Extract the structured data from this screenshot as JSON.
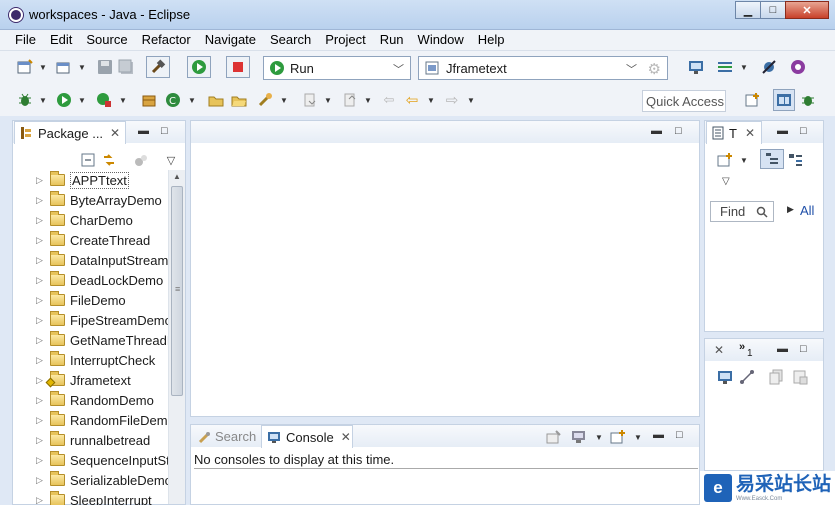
{
  "window": {
    "title": "workspaces - Java - Eclipse",
    "minimize": "▁",
    "maximize": "□",
    "close": "✕"
  },
  "menu": [
    "File",
    "Edit",
    "Source",
    "Refactor",
    "Navigate",
    "Search",
    "Project",
    "Run",
    "Window",
    "Help"
  ],
  "toolbar": {
    "run_config": "Run",
    "project": "Jframetext",
    "quick_access": "Quick Access"
  },
  "package_explorer": {
    "tab_label": "Package ...",
    "projects": [
      "APPTtext",
      "ByteArrayDemo",
      "CharDemo",
      "CreateThread",
      "DataInputStreamDe",
      "DeadLockDemo",
      "FileDemo",
      "FipeStreamDemo",
      "GetNameThreadDe",
      "InterruptCheck",
      "Jframetext",
      "RandomDemo",
      "RandomFileDemo",
      "runnalbetread",
      "SequenceInputStre",
      "SerializableDemo",
      "SleepInterrupt"
    ],
    "selected_index": 0
  },
  "task_list": {
    "tab_label": "T",
    "find_placeholder": "Find",
    "all_link": "All"
  },
  "outline": {
    "overflow_count": "1"
  },
  "console_area": {
    "search_tab": "Search",
    "console_tab": "Console",
    "message": "No consoles to display at this time."
  },
  "watermark": {
    "cn": "易采站长站",
    "en": "Www.Easck.Com"
  }
}
